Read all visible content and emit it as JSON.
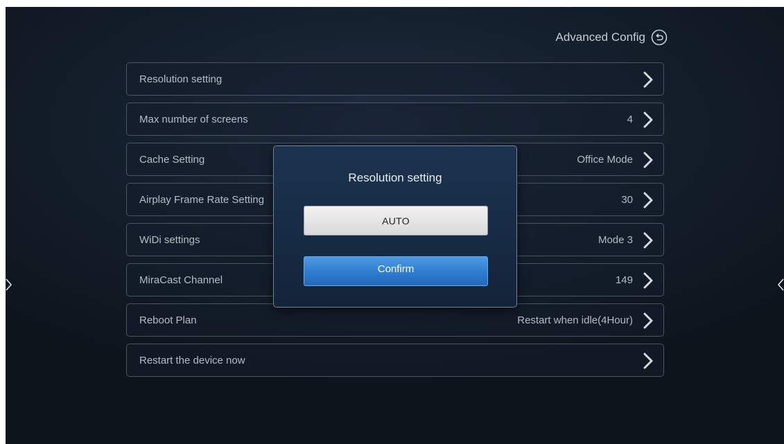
{
  "header": {
    "title": "Advanced Config",
    "back_icon": "back-circle-icon"
  },
  "settings": {
    "items": [
      {
        "label": "Resolution setting",
        "value": ""
      },
      {
        "label": "Max number of screens",
        "value": "4"
      },
      {
        "label": "Cache Setting",
        "value": "Office Mode"
      },
      {
        "label": "Airplay Frame Rate Setting",
        "value": "30"
      },
      {
        "label": "WiDi settings",
        "value": "Mode 3"
      },
      {
        "label": "MiraCast Channel",
        "value": "149"
      },
      {
        "label": "Reboot Plan",
        "value": "Restart when idle(4Hour)"
      },
      {
        "label": "Restart the device now",
        "value": ""
      }
    ]
  },
  "dialog": {
    "title": "Resolution setting",
    "selected_option": "AUTO",
    "confirm_label": "Confirm"
  },
  "colors": {
    "background": "#15202e",
    "dialog_background": "#1c3350",
    "confirm_accent": "#2e7cd1",
    "text": "#b5bcc4"
  }
}
